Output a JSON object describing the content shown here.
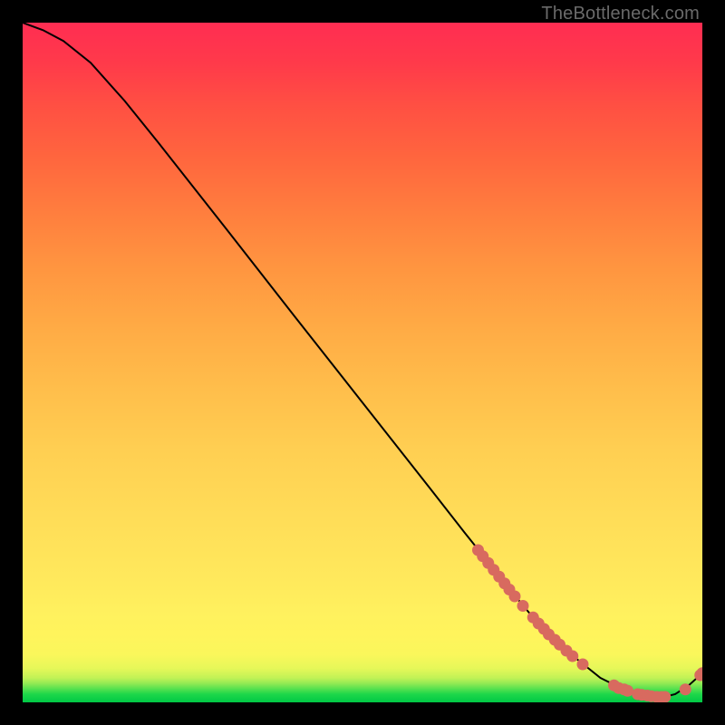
{
  "watermark": "TheBottleneck.com",
  "chart_data": {
    "type": "line",
    "title": "",
    "xlabel": "",
    "ylabel": "",
    "xlim": [
      0,
      100
    ],
    "ylim": [
      0,
      100
    ],
    "series": [
      {
        "name": "curve",
        "x": [
          0,
          3,
          6,
          10,
          15,
          20,
          30,
          40,
          50,
          60,
          65,
          67,
          69,
          71,
          73,
          75,
          77,
          79,
          81,
          83,
          85,
          87,
          89,
          90.5,
          92,
          94,
          96,
          98,
          100
        ],
        "y": [
          100,
          98.9,
          97.3,
          94.1,
          88.5,
          82.3,
          69.6,
          56.8,
          44.1,
          31.4,
          25,
          22.5,
          19.9,
          17.4,
          15,
          12.6,
          10.5,
          8.7,
          6.8,
          5.2,
          3.6,
          2.6,
          1.7,
          1.2,
          0.9,
          0.7,
          1.2,
          2.5,
          4.3
        ]
      }
    ],
    "markers": [
      {
        "x": 67.0,
        "y": 22.4
      },
      {
        "x": 67.7,
        "y": 21.5
      },
      {
        "x": 68.5,
        "y": 20.5
      },
      {
        "x": 69.3,
        "y": 19.5
      },
      {
        "x": 70.1,
        "y": 18.5
      },
      {
        "x": 70.9,
        "y": 17.5
      },
      {
        "x": 71.6,
        "y": 16.6
      },
      {
        "x": 72.4,
        "y": 15.6
      },
      {
        "x": 73.6,
        "y": 14.2
      },
      {
        "x": 75.1,
        "y": 12.5
      },
      {
        "x": 75.9,
        "y": 11.6
      },
      {
        "x": 76.7,
        "y": 10.8
      },
      {
        "x": 77.4,
        "y": 10.0
      },
      {
        "x": 78.3,
        "y": 9.2
      },
      {
        "x": 79.0,
        "y": 8.5
      },
      {
        "x": 80.0,
        "y": 7.6
      },
      {
        "x": 80.9,
        "y": 6.8
      },
      {
        "x": 82.4,
        "y": 5.6
      },
      {
        "x": 87.0,
        "y": 2.5
      },
      {
        "x": 87.7,
        "y": 2.1
      },
      {
        "x": 88.5,
        "y": 1.9
      },
      {
        "x": 89.0,
        "y": 1.7
      },
      {
        "x": 90.5,
        "y": 1.2
      },
      {
        "x": 91.1,
        "y": 1.1
      },
      {
        "x": 91.9,
        "y": 1.0
      },
      {
        "x": 92.5,
        "y": 0.9
      },
      {
        "x": 93.3,
        "y": 0.8
      },
      {
        "x": 94.0,
        "y": 0.8
      },
      {
        "x": 94.5,
        "y": 0.8
      },
      {
        "x": 97.5,
        "y": 1.9
      },
      {
        "x": 99.7,
        "y": 4.0
      },
      {
        "x": 100.0,
        "y": 4.3
      }
    ],
    "marker_color": "#d86a5f",
    "marker_radius": 6.5,
    "line_color": "#000000",
    "line_width": 2
  }
}
